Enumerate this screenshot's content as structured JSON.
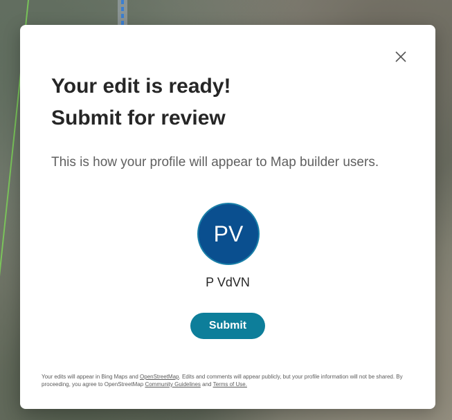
{
  "modal": {
    "title_line1": "Your edit is ready!",
    "title_line2": "Submit for review",
    "subtitle": "This is how your profile will appear to Map builder users.",
    "avatar_initials": "PV",
    "profile_name": "P VdVN",
    "submit_label": "Submit",
    "close_icon": "close-icon",
    "footer": {
      "text1": "Your edits will appear in Bing Maps and ",
      "link_osm": "OpenStreetMap",
      "text2": ". Edits and comments will appear publicly, but your profile information will not be shared. By proceeding, you agree to OpenStreetMap ",
      "link_guidelines": "Community Guidelines",
      "text3": " and ",
      "link_terms": "Terms of Use.",
      "text4": ""
    }
  },
  "colors": {
    "accent": "#0d7e9a",
    "avatar_bg": "#0a4f8f",
    "title": "#262626"
  }
}
